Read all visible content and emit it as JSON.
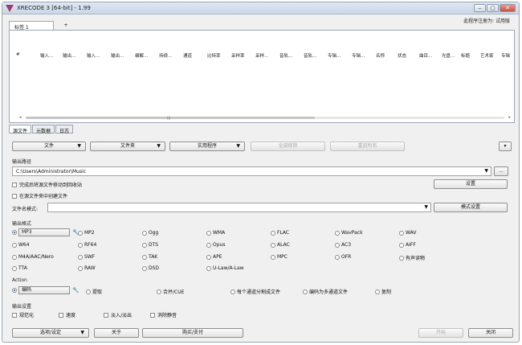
{
  "window": {
    "title": "XRECODE 3 [64-bit] - 1.99",
    "registered_to": "此程序注册为: 试用版",
    "controls": [
      "‒",
      "▢",
      "✕"
    ]
  },
  "top_tabs": [
    {
      "label": "标签 1"
    },
    {
      "label": "+"
    }
  ],
  "list": {
    "columns": [
      "#",
      "输入...",
      "输出...",
      "输入...",
      "输出...",
      "编解...",
      "持续...",
      "通道",
      "比特率",
      "采样率",
      "采样...",
      "音轨...",
      "音轨...",
      "专辑...",
      "专辑...",
      "名称",
      "状态",
      "曲目...",
      "光盘...",
      "标题",
      "艺术家",
      "专辑"
    ],
    "scroll_center": "|||"
  },
  "bottom_tabs": [
    {
      "label": "源文件"
    },
    {
      "label": "元数据"
    },
    {
      "label": "日志"
    }
  ],
  "toolbar": {
    "files": "文件",
    "folders": "文件夹",
    "utilities": "实用程序",
    "remove_all": "全部移除",
    "repeat_all": "重放所有",
    "more": "▾"
  },
  "output_path": {
    "label": "输出路径",
    "value": "C:\\Users\\Administrator\\Music",
    "browse": "...",
    "opt_recycle": "完成后将源文件移动到回收站",
    "opt_create_in_source": "在源文件夹中创建文件",
    "settings_button": "设置",
    "filename_pattern_label": "文件名模式:",
    "pattern_settings_button": "模式设置"
  },
  "output_format": {
    "label": "输出格式",
    "rows": [
      [
        "MP3",
        "MP2",
        "Ogg",
        "WMA",
        "FLAC",
        "WavPack",
        "WAV"
      ],
      [
        "W64",
        "RF64",
        "DTS",
        "Opus",
        "ALAC",
        "AC3",
        "AIFF"
      ],
      [
        "M4A/AAC/Nero",
        "SWF",
        "TAK",
        "APE",
        "MPC",
        "OFR",
        "有声读物"
      ],
      [
        "TTA",
        "RAW",
        "DSD",
        "U-Law/A-Law"
      ]
    ],
    "selected": "MP3"
  },
  "action": {
    "label": "Action",
    "options": [
      "编码",
      "提取",
      "合并/CUE",
      "每个通道分割成文件",
      "编码为多通道文件",
      "复制"
    ],
    "selected": "编码"
  },
  "output_settings": {
    "label": "输出设置",
    "options": [
      "规范化",
      "速度",
      "淡入/淡出",
      "消除静音"
    ]
  },
  "bottom": {
    "options_settings": "选项/设定",
    "about": "关于",
    "buy": "购买/支付",
    "start": "开始",
    "close": "关闭"
  }
}
